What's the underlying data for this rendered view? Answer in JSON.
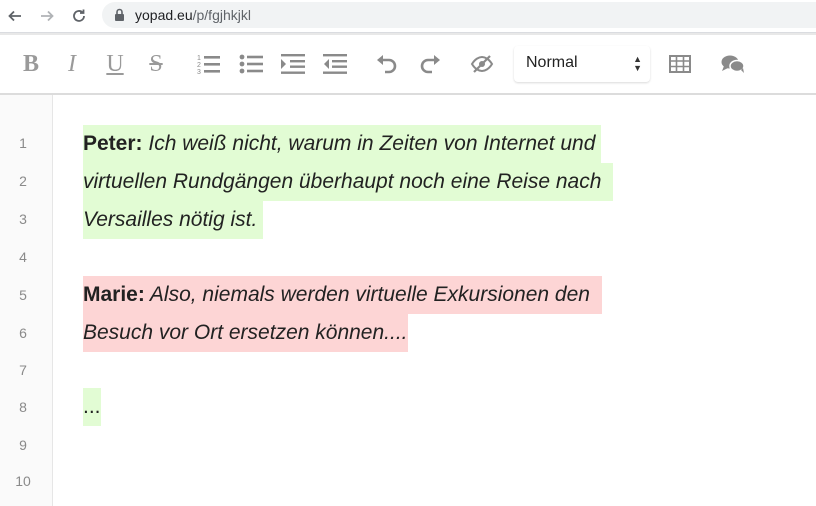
{
  "browser": {
    "url_domain": "yopad.eu",
    "url_path": "/p/fgjhkjkl"
  },
  "toolbar": {
    "bold_label": "B",
    "italic_label": "I",
    "underline_label": "U",
    "strike_label": "S",
    "style_select_value": "Normal"
  },
  "editor": {
    "line_numbers": [
      "1",
      "2",
      "3",
      "4",
      "5",
      "6",
      "7",
      "8",
      "9",
      "10"
    ],
    "speaker_peter": "Peter:",
    "line1_text": " Ich weiß nicht, warum in Zeiten von Internet und",
    "line2_text": "virtuellen Rundgängen überhaupt noch eine Reise nach",
    "line3_text": "Versailles nötig ist.",
    "speaker_marie": "Marie:",
    "line5_text": " Also, niemals werden virtuelle Exkursionen den",
    "line6_text": "Besuch vor Ort ersetzen können....",
    "line8_text": "..."
  },
  "colors": {
    "highlight_green": "#e2fcd4",
    "highlight_red": "#fdd5d5"
  }
}
